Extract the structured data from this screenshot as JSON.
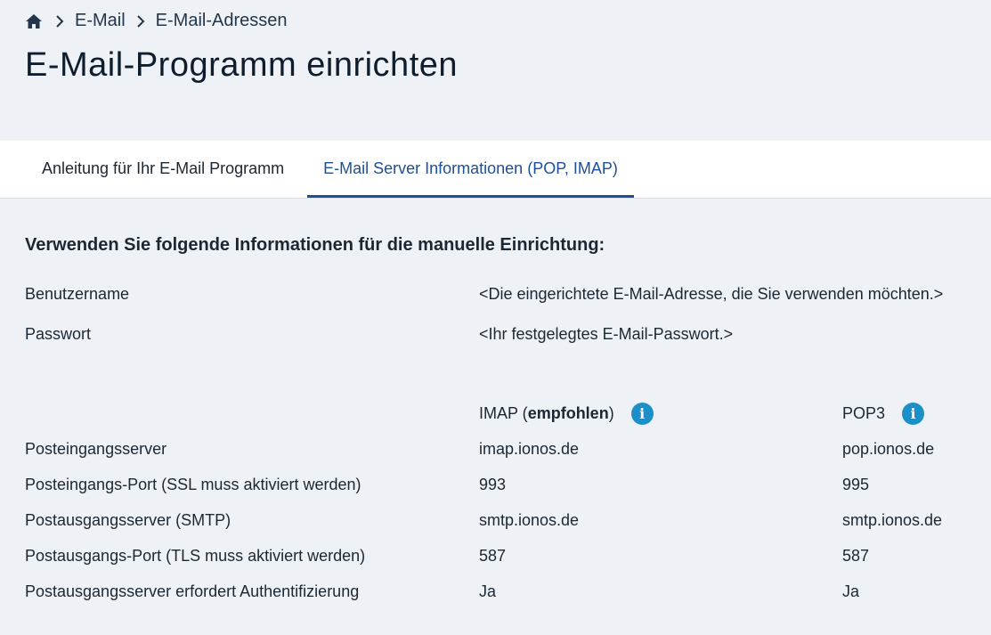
{
  "breadcrumb": {
    "items": [
      {
        "label": "E-Mail"
      },
      {
        "label": "E-Mail-Adressen"
      }
    ]
  },
  "page_title": "E-Mail-Programm einrichten",
  "tabs": [
    {
      "label": "Anleitung für Ihr E-Mail Programm",
      "active": false
    },
    {
      "label": "E-Mail Server Informationen (POP, IMAP)",
      "active": true
    }
  ],
  "section_heading": "Verwenden Sie folgende Informationen für die manuelle Einrichtung:",
  "credentials": [
    {
      "label": "Benutzername",
      "value": "<Die eingerichtete E-Mail-Adresse, die Sie verwenden möchten.>"
    },
    {
      "label": "Passwort",
      "value": "<Ihr festgelegtes E-Mail-Passwort.>"
    }
  ],
  "columns": {
    "imap_prefix": "IMAP (",
    "imap_bold": "empfohlen",
    "imap_suffix": ")",
    "pop3": "POP3"
  },
  "server_rows": [
    {
      "label": "Posteingangsserver",
      "imap": "imap.ionos.de",
      "pop3": "pop.ionos.de"
    },
    {
      "label": "Posteingangs-Port (SSL muss aktiviert werden)",
      "imap": "993",
      "pop3": "995"
    },
    {
      "label": "Postausgangsserver (SMTP)",
      "imap": "smtp.ionos.de",
      "pop3": "smtp.ionos.de"
    },
    {
      "label": "Postausgangs-Port (TLS muss aktiviert werden)",
      "imap": "587",
      "pop3": "587"
    },
    {
      "label": "Postausgangsserver erfordert Authentifizierung",
      "imap": "Ja",
      "pop3": "Ja"
    }
  ],
  "colors": {
    "accent": "#1e4f99",
    "info": "#1c8fc9",
    "background": "#eef2f6"
  }
}
